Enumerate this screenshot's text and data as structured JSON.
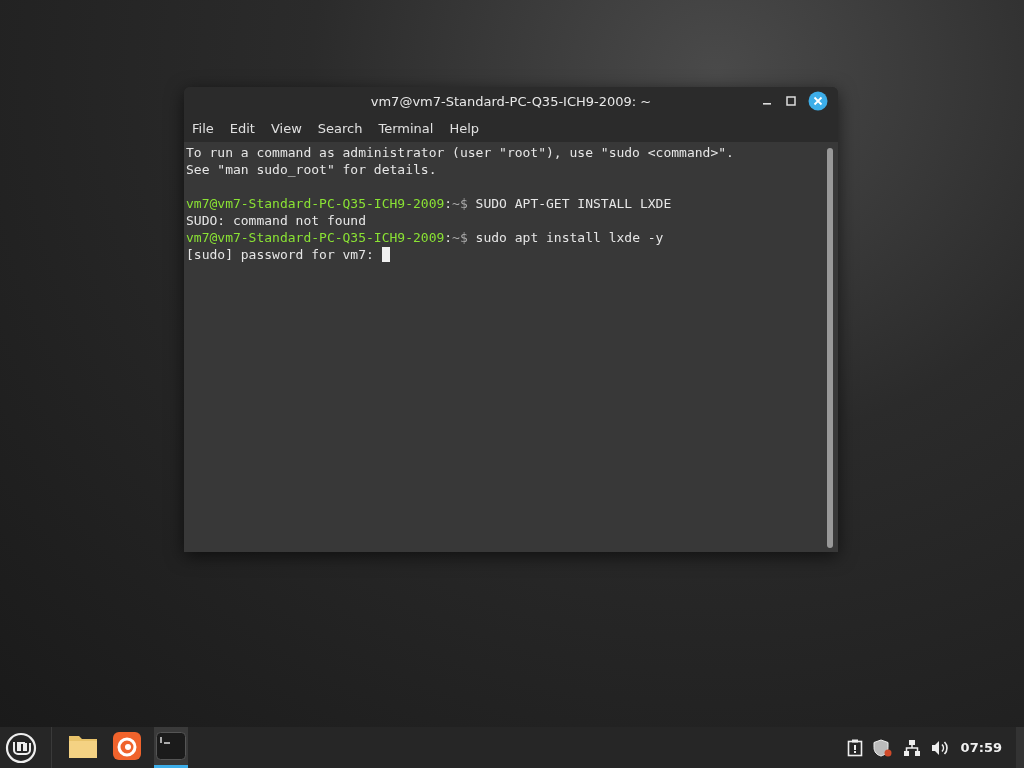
{
  "window": {
    "title": "vm7@vm7-Standard-PC-Q35-ICH9-2009: ~"
  },
  "menu": [
    "File",
    "Edit",
    "View",
    "Search",
    "Terminal",
    "Help"
  ],
  "terminal": {
    "lines": [
      {
        "kind": "text",
        "text": "To run a command as administrator (user \"root\"), use \"sudo <command>\"."
      },
      {
        "kind": "text",
        "text": "See \"man sudo_root\" for details."
      },
      {
        "kind": "blank"
      },
      {
        "kind": "prompt",
        "user_host": "vm7@vm7-Standard-PC-Q35-ICH9-2009",
        "sep": ":",
        "path": "~$",
        "command": "SUDO APT-GET INSTALL LXDE"
      },
      {
        "kind": "text",
        "text": "SUDO: command not found"
      },
      {
        "kind": "prompt",
        "user_host": "vm7@vm7-Standard-PC-Q35-ICH9-2009",
        "sep": ":",
        "path": "~$",
        "command": "sudo apt install lxde -y"
      },
      {
        "kind": "text",
        "text": "[sudo] password for vm7:",
        "cursor": true
      }
    ]
  },
  "taskbar": {
    "launchers": [
      {
        "kind": "files",
        "selected": false
      },
      {
        "kind": "browser",
        "selected": false
      },
      {
        "kind": "terminal",
        "selected": true
      }
    ],
    "clock": "07:59"
  }
}
